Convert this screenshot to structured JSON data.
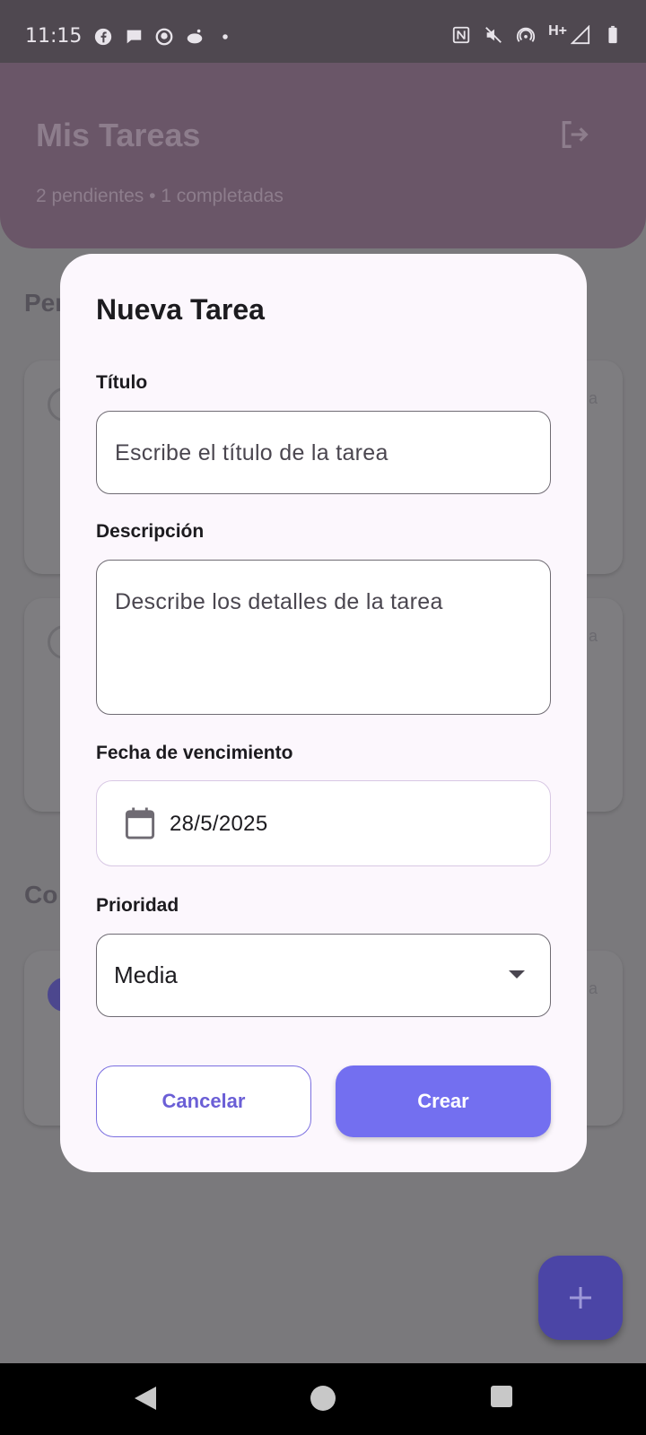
{
  "status_bar": {
    "time": "11:15",
    "left_icons": [
      "facebook-icon",
      "messenger-icon",
      "github-icon",
      "reddit-icon",
      "dot-icon"
    ],
    "right_icons": [
      "nfc-icon",
      "mute-icon",
      "hotspot-icon",
      "signal-h-plus-icon",
      "battery-icon"
    ],
    "network_label": "H+"
  },
  "header": {
    "title": "Mis Tareas",
    "subtitle": "2 pendientes • 1 completadas",
    "logout_icon": "logout-icon"
  },
  "background": {
    "section_pending": "Pen",
    "section_completed": "Co",
    "card_side_text": "a"
  },
  "dialog": {
    "title": "Nueva Tarea",
    "title_label": "Título",
    "title_placeholder": "Escribe el título de la tarea",
    "description_label": "Descripción",
    "description_placeholder": "Describe los detalles de la tarea",
    "due_label": "Fecha de vencimiento",
    "due_value": "28/5/2025",
    "priority_label": "Prioridad",
    "priority_value": "Media",
    "cancel_label": "Cancelar",
    "create_label": "Crear"
  },
  "colors": {
    "accent": "#736ff0",
    "dialog_bg": "#fcf7fd",
    "header_bg": "#6a5668"
  }
}
